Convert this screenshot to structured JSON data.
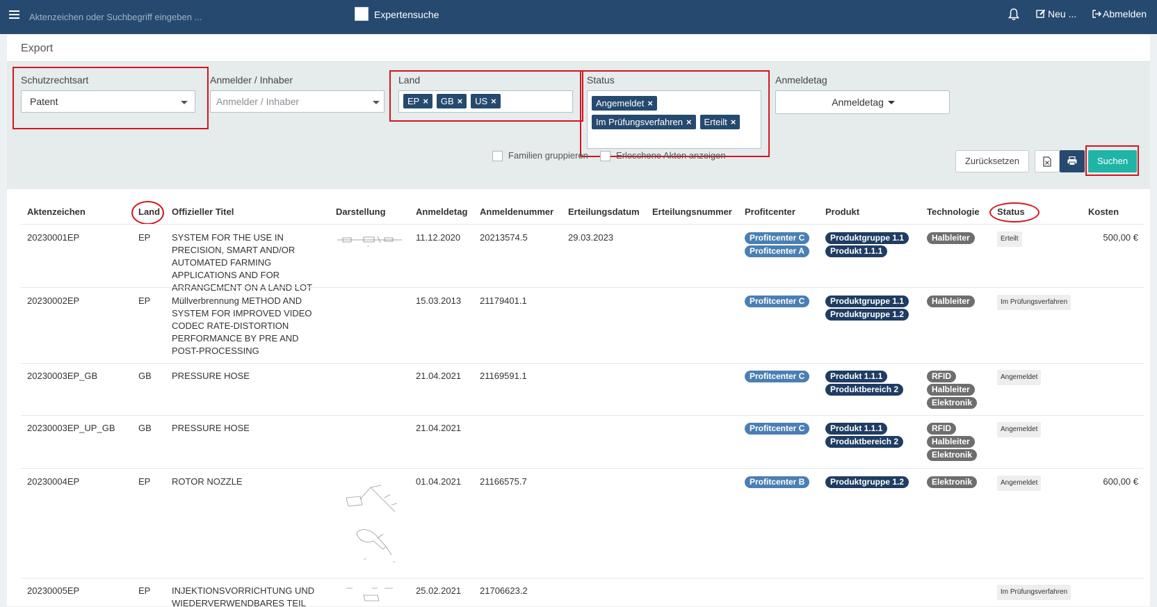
{
  "topbar": {
    "search_placeholder": "Aktenzeichen oder Suchbegriff eingeben ...",
    "expert_label": "Expertensuche",
    "new_label": "Neu ...",
    "logout_label": "Abmelden"
  },
  "panel": {
    "title": "Export",
    "filters": {
      "schutzrechtsart": {
        "label": "Schutzrechtsart",
        "value": "Patent"
      },
      "anmelder": {
        "label": "Anmelder / Inhaber",
        "placeholder": "Anmelder / Inhaber"
      },
      "land": {
        "label": "Land",
        "tags": [
          "EP",
          "GB",
          "US"
        ]
      },
      "status": {
        "label": "Status",
        "tags": [
          "Angemeldet",
          "Im Prüfungsverfahren",
          "Erteilt"
        ]
      },
      "anmeldetag": {
        "label": "Anmeldetag",
        "button": "Anmeldetag"
      }
    },
    "checkboxes": {
      "familien": "Familien gruppieren",
      "erloschene": "Erloschene Akten anzeigen"
    },
    "buttons": {
      "reset": "Zurücksetzen",
      "search": "Suchen"
    }
  },
  "table": {
    "headers": {
      "aktenzeichen": "Aktenzeichen",
      "land": "Land",
      "titel": "Offizieller Titel",
      "darstellung": "Darstellung",
      "anmeldetag": "Anmeldetag",
      "anmeldenummer": "Anmeldenummer",
      "erteilungsdatum": "Erteilungsdatum",
      "erteilungsnummer": "Erteilungsnummer",
      "profitcenter": "Profitcenter",
      "produkt": "Produkt",
      "technologie": "Technologie",
      "status": "Status",
      "kosten": "Kosten"
    },
    "rows": [
      {
        "aktenzeichen": "20230001EP",
        "land": "EP",
        "title": "SYSTEM FOR THE USE IN PRECISION, SMART AND/OR AUTOMATED FARMING APPLICATIONS AND FOR ARRANGEMENT ON A LAND LOT",
        "anmeldetag": "11.12.2020",
        "anmeldenummer": "20213574.5",
        "erteilungsdatum": "29.03.2023",
        "profitcenter": [
          "Profitcenter C",
          "Profitcenter A"
        ],
        "produkt": [
          "Produktgruppe 1.1",
          "Produkt 1.1.1"
        ],
        "technologie": [
          "Halbleiter"
        ],
        "status": "Erteilt",
        "kosten": "500,00 €"
      },
      {
        "aktenzeichen": "20230002EP",
        "land": "EP",
        "title": "Müllverbrennung METHOD AND SYSTEM FOR IMPROVED VIDEO CODEC RATE-DISTORTION PERFORMANCE BY PRE AND POST-PROCESSING",
        "anmeldetag": "15.03.2013",
        "anmeldenummer": "21179401.1",
        "erteilungsdatum": "",
        "profitcenter": [
          "Profitcenter C"
        ],
        "produkt": [
          "Produktgruppe 1.1",
          "Produktgruppe 1.2"
        ],
        "technologie": [
          "Halbleiter"
        ],
        "status": "Im Prüfungsverfahren",
        "kosten": ""
      },
      {
        "aktenzeichen": "20230003EP_GB",
        "land": "GB",
        "title": "PRESSURE HOSE",
        "anmeldetag": "21.04.2021",
        "anmeldenummer": "21169591.1",
        "erteilungsdatum": "",
        "profitcenter": [
          "Profitcenter C"
        ],
        "produkt": [
          "Produkt 1.1.1",
          "Produktbereich 2"
        ],
        "technologie": [
          "RFID",
          "Halbleiter",
          "Elektronik"
        ],
        "status": "Angemeldet",
        "kosten": ""
      },
      {
        "aktenzeichen": "20230003EP_UP_GB",
        "land": "GB",
        "title": "PRESSURE HOSE",
        "anmeldetag": "21.04.2021",
        "anmeldenummer": "",
        "erteilungsdatum": "",
        "profitcenter": [
          "Profitcenter C"
        ],
        "produkt": [
          "Produkt 1.1.1",
          "Produktbereich 2"
        ],
        "technologie": [
          "RFID",
          "Halbleiter",
          "Elektronik"
        ],
        "status": "Angemeldet",
        "kosten": ""
      },
      {
        "aktenzeichen": "20230004EP",
        "land": "EP",
        "title": "ROTOR NOZZLE",
        "anmeldetag": "01.04.2021",
        "anmeldenummer": "21166575.7",
        "erteilungsdatum": "",
        "profitcenter": [
          "Profitcenter B"
        ],
        "produkt": [
          "Produktgruppe 1.2"
        ],
        "technologie": [
          "Elektronik"
        ],
        "status": "Angemeldet",
        "kosten": "600,00 €"
      },
      {
        "aktenzeichen": "20230005EP",
        "land": "EP",
        "title": "INJEKTIONSVORRICHTUNG UND WIEDERVERWENDBARES TEIL",
        "anmeldetag": "25.02.2021",
        "anmeldenummer": "21706623.2",
        "erteilungsdatum": "",
        "profitcenter": [],
        "produkt": [],
        "technologie": [],
        "status": "Im Prüfungsverfahren",
        "kosten": ""
      }
    ]
  },
  "colors": {
    "topbar": "#264a6f",
    "accent": "#1fb5a6",
    "highlight": "#d2161e",
    "profitcenter": "#4a7fb3",
    "produkt": "#1f3d63",
    "technologie": "#6e6e6e"
  }
}
